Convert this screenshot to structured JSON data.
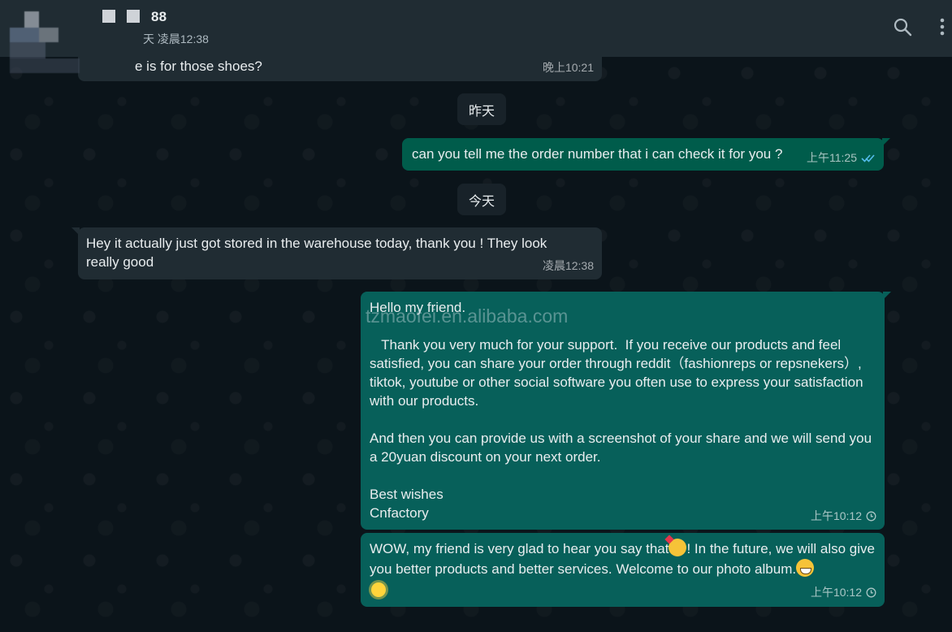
{
  "header": {
    "contact_name": "88",
    "last_seen_prefix": "天",
    "last_seen_time": "凌晨12:38"
  },
  "messages": [
    {
      "id": "m1",
      "text": "e is for those shoes?",
      "time": "晚上10:21",
      "direction": "in"
    },
    {
      "id": "chip1",
      "text": "昨天"
    },
    {
      "id": "m2",
      "text": "can you tell me the order number that i can check it for you ?",
      "time": "上午11:25",
      "direction": "out",
      "status": "read"
    },
    {
      "id": "chip2",
      "text": "今天"
    },
    {
      "id": "m3",
      "text": "Hey it actually just got stored in the warehouse today, thank you ! They look really good",
      "time": "凌晨12:38",
      "direction": "in"
    },
    {
      "id": "m4",
      "direction": "out",
      "time": "上午10:12",
      "status": "pending",
      "lines": [
        "Hello my friend.",
        "   Thank you very much for your support.  If you receive our products and feel satisfied, you can share your order through reddit（fashionreps or repsnekers）, tiktok, youtube or other social software you often use to express your satisfaction with our products.",
        "And then you can provide us with a screenshot of your share and we will send you a 20yuan discount on your next order.",
        "Best wishes",
        "Cnfactory"
      ]
    },
    {
      "id": "m5",
      "direction": "out",
      "time": "上午10:12",
      "status": "pending",
      "text_a": "WOW, my friend is very glad to hear you say that",
      "text_b": "! In the future, we will also give you better products and better services. Welcome to our photo album.",
      "emojis": [
        "smiling-face-with-hearts",
        "grinning-face",
        "sun"
      ]
    }
  ],
  "watermark": "tzmaofei.en.alibaba.com",
  "icons": [
    "search-icon",
    "more-vertical-icon",
    "double-check-icon",
    "clock-icon"
  ],
  "colors": {
    "incoming": "#202c33",
    "outgoing": "#005c4b",
    "read_tick": "#53bdeb"
  }
}
